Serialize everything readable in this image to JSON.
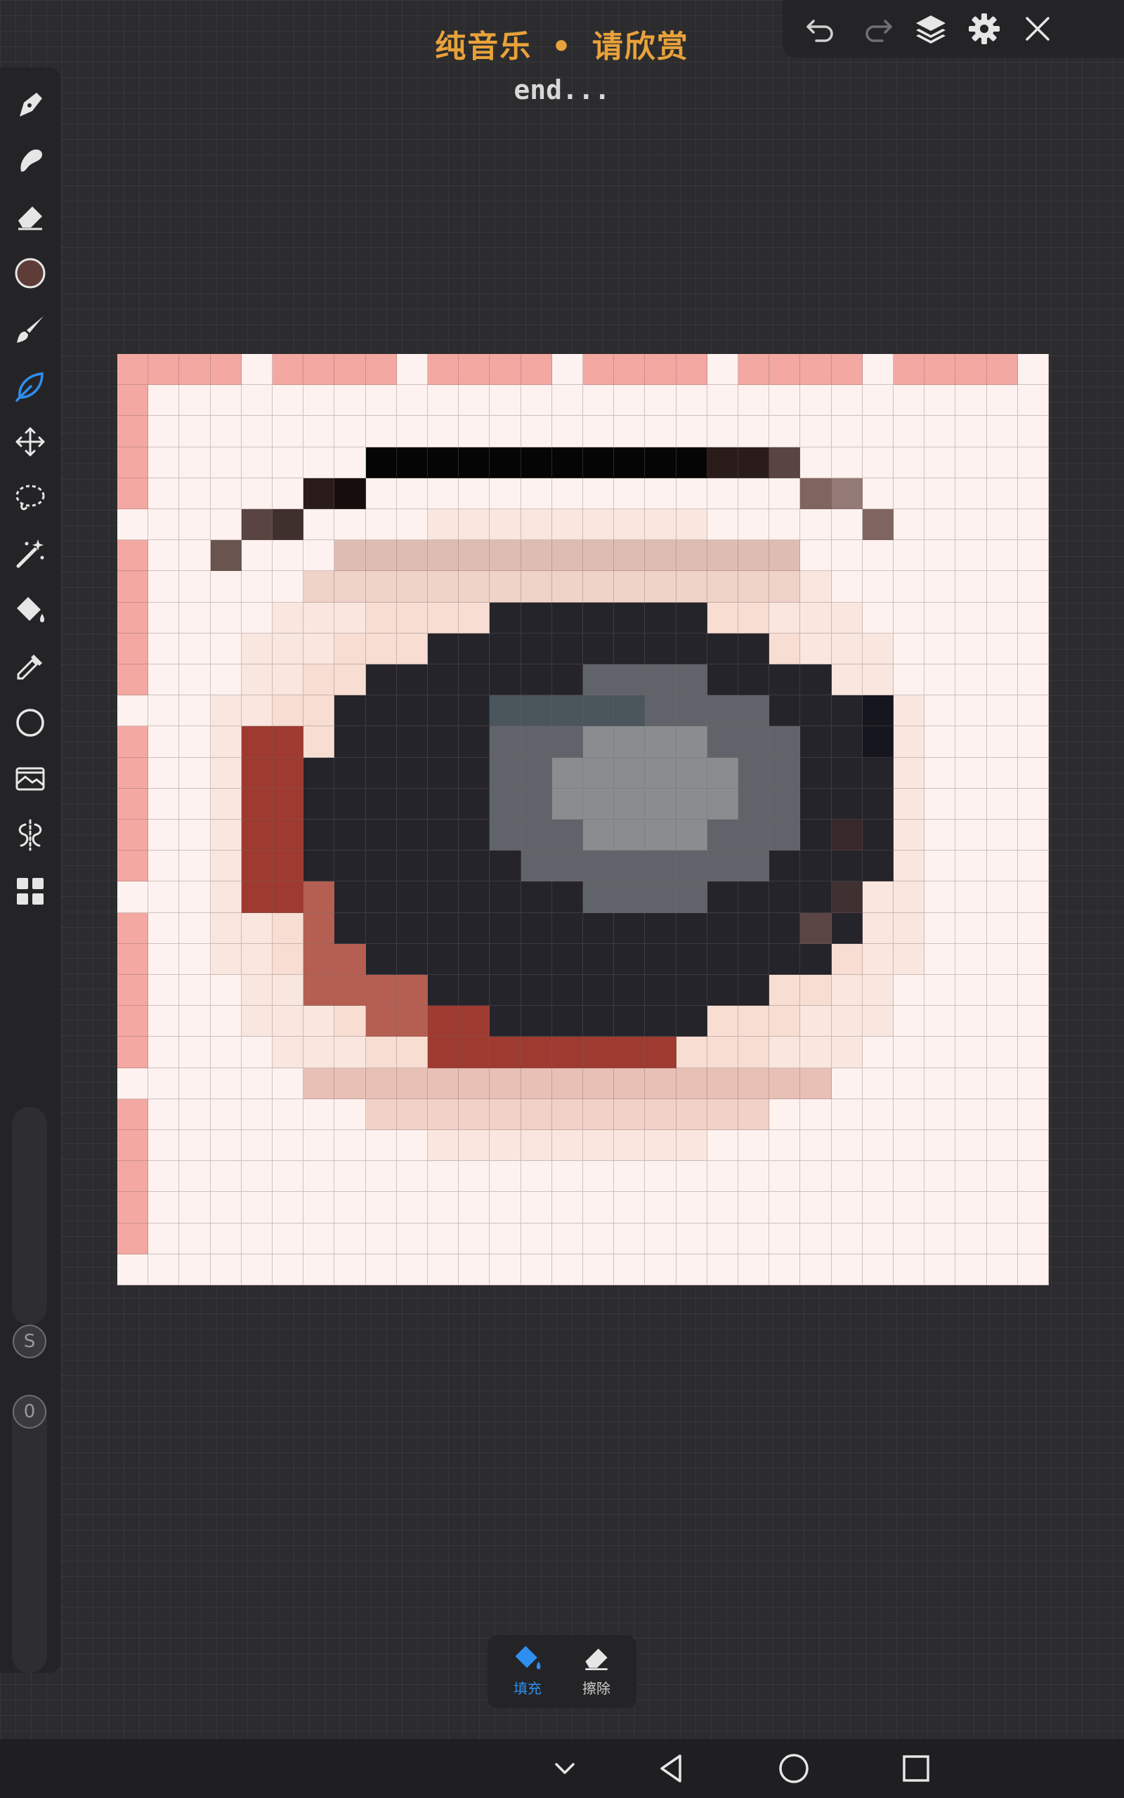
{
  "header": {
    "title": "纯音乐 • 请欣赏",
    "subtitle": "end..."
  },
  "topbar": {
    "icons": [
      "undo-icon",
      "redo-icon",
      "layers-icon",
      "gear-icon",
      "close-icon"
    ]
  },
  "toolbar": {
    "tools": [
      "pen-icon",
      "smudge-icon",
      "eraser-icon",
      "color-swatch",
      "brush-icon",
      "pencil-leaf-icon",
      "move-icon",
      "lasso-icon",
      "magic-wand-icon",
      "paint-bucket-icon",
      "eyedropper-icon",
      "shape-circle-icon",
      "image-icon",
      "symmetry-icon",
      "grid-apps-icon"
    ],
    "active_tool": "pencil-leaf-icon",
    "current_color": "#5e3d38",
    "size_label": "S",
    "opacity_label": "0"
  },
  "mode": {
    "fill_label": "填充",
    "erase_label": "擦除"
  },
  "colors": {
    "accent": "#2f8ff0",
    "title": "#e8a23a"
  },
  "canvas": {
    "grid_size": 30,
    "note": ""
  }
}
